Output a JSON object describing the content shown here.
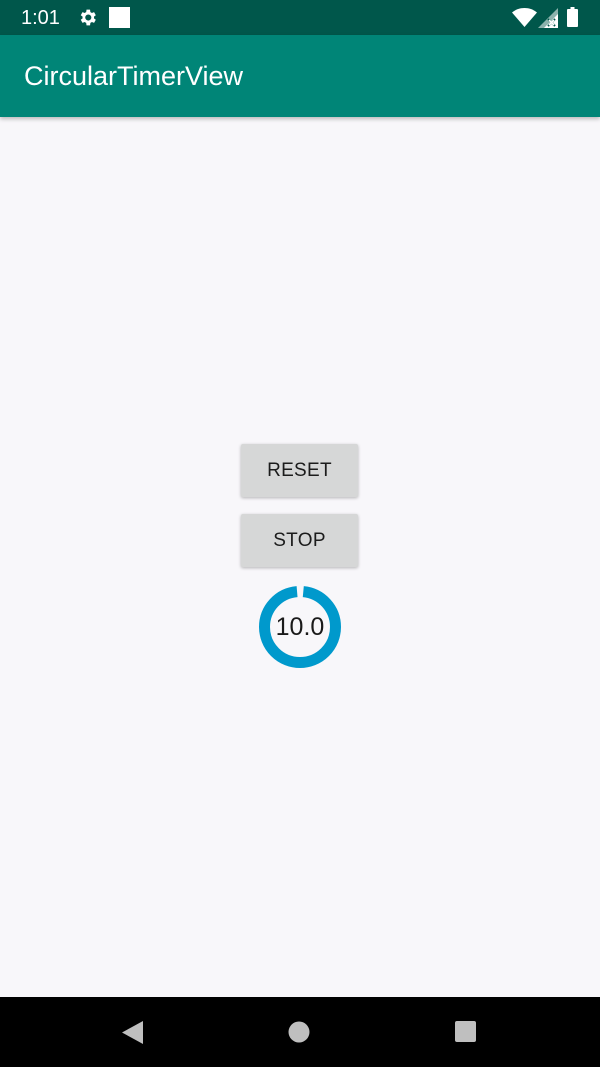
{
  "status_bar": {
    "time": "1:01",
    "icons": [
      "gear-icon",
      "notification-square-icon",
      "wifi-icon",
      "signal-icon",
      "battery-icon"
    ],
    "background": "#00574b"
  },
  "app_bar": {
    "title": "CircularTimerView",
    "background": "#008577"
  },
  "buttons": {
    "reset_label": "RESET",
    "stop_label": "STOP"
  },
  "timer": {
    "value": "10.0",
    "progress_fraction": 0.97,
    "ring_color": "#0099cc"
  },
  "nav_bar": {
    "icons": [
      "back-icon",
      "home-icon",
      "recents-icon"
    ],
    "background": "#000000"
  }
}
